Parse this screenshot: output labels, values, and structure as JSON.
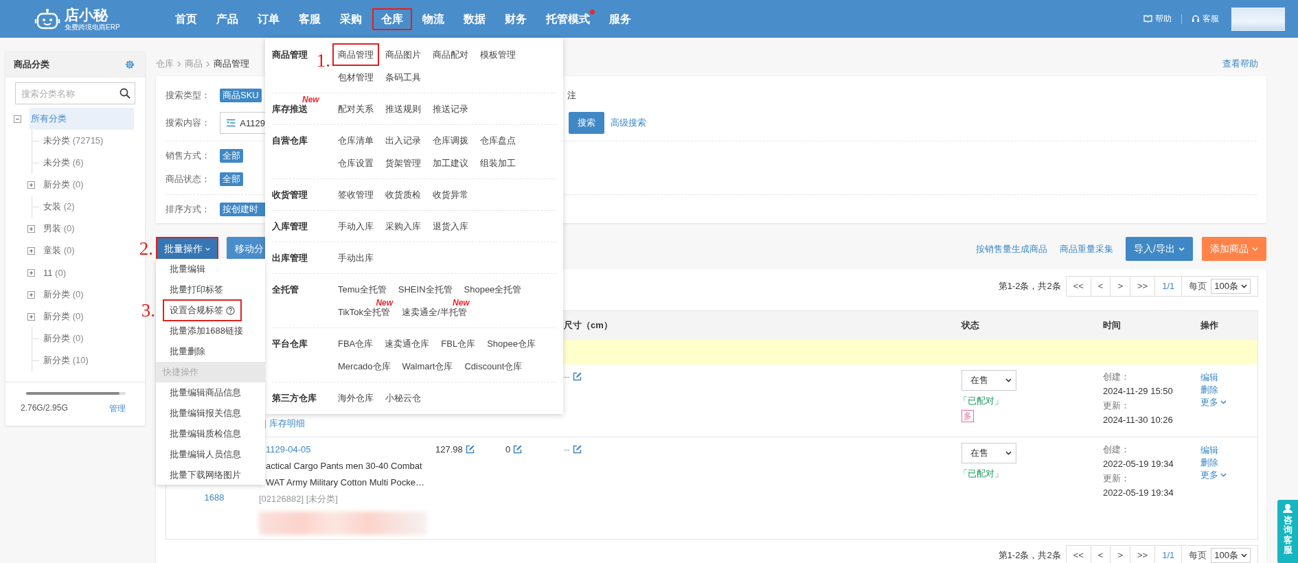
{
  "header": {
    "logo": {
      "name": "店小秘",
      "tagline": "免费跨境电商ERP"
    },
    "nav": [
      {
        "label": "首页",
        "boxed": false,
        "dot": false
      },
      {
        "label": "产品",
        "boxed": false,
        "dot": false
      },
      {
        "label": "订单",
        "boxed": false,
        "dot": false
      },
      {
        "label": "客服",
        "boxed": false,
        "dot": false
      },
      {
        "label": "采购",
        "boxed": false,
        "dot": false
      },
      {
        "label": "仓库",
        "boxed": true,
        "dot": false
      },
      {
        "label": "物流",
        "boxed": false,
        "dot": false
      },
      {
        "label": "数据",
        "boxed": false,
        "dot": false
      },
      {
        "label": "财务",
        "boxed": false,
        "dot": false
      },
      {
        "label": "托管模式",
        "boxed": false,
        "dot": true
      },
      {
        "label": "服务",
        "boxed": false,
        "dot": false
      }
    ],
    "links": [
      {
        "label": "帮助",
        "kind": "help"
      },
      {
        "label": "客服",
        "kind": "service"
      }
    ]
  },
  "sidebar": {
    "title": "商品分类",
    "search_placeholder": "搜索分类名称",
    "tree": [
      {
        "label": "所有分类",
        "kind": "folder",
        "expanded": true,
        "selected": true,
        "children": [
          {
            "label": "未分类",
            "count": "(72715)",
            "kind": "leaf",
            "selected": false
          },
          {
            "label": "未分类",
            "count": "(6)",
            "kind": "leaf",
            "selected": false
          },
          {
            "label": "新分类",
            "count": "(0)",
            "kind": "folder",
            "expanded": false,
            "selected": false
          },
          {
            "label": "女装",
            "count": "(2)",
            "kind": "leaf",
            "selected": false
          },
          {
            "label": "男装",
            "count": "(0)",
            "kind": "folder",
            "expanded": false,
            "selected": false
          },
          {
            "label": "童装",
            "count": "(0)",
            "kind": "folder",
            "expanded": false,
            "selected": false
          },
          {
            "label": "11",
            "count": "(0)",
            "kind": "folder",
            "expanded": false,
            "selected": false
          },
          {
            "label": "新分类",
            "count": "(0)",
            "kind": "folder",
            "expanded": false,
            "selected": false
          },
          {
            "label": "新分类",
            "count": "(0)",
            "kind": "folder",
            "expanded": false,
            "selected": false
          },
          {
            "label": "新分类",
            "count": "(0)",
            "kind": "leaf",
            "selected": false
          },
          {
            "label": "新分类",
            "count": "(10)",
            "kind": "leaf",
            "selected": false
          }
        ]
      }
    ],
    "storage": {
      "level": 0.935,
      "text": "2.76G/2.95G",
      "link": "管理"
    }
  },
  "breadcrumb": [
    "仓库",
    "商品",
    "商品管理"
  ],
  "help_link": "查看帮助",
  "search": {
    "groups": [
      [
        {
          "label": "搜索类型：",
          "kind": "tags",
          "tag": "商品SKU",
          "trailing": "注"
        },
        {
          "label": "搜索内容：",
          "kind": "input",
          "value": "A1129",
          "button": "搜索",
          "link": "高级搜索"
        }
      ],
      [
        {
          "label": "销售方式：",
          "kind": "tags",
          "tag": "全部"
        },
        {
          "label": "商品状态：",
          "kind": "tags",
          "tag": "全部"
        }
      ],
      [
        {
          "label": "排序方式：",
          "kind": "tags",
          "tag": "按创建时"
        }
      ]
    ]
  },
  "toolbar": {
    "left": [
      {
        "label": "批量操作",
        "kind": "dropdown",
        "boxed": true,
        "annotation": "2."
      },
      {
        "label": "移动分",
        "kind": "plain",
        "boxed": false
      }
    ],
    "links": [
      "按销售量生成商品",
      "商品重量采集"
    ],
    "buttons": [
      {
        "label": "导入/导出",
        "kind": "primary"
      },
      {
        "label": "添加商品",
        "kind": "warning"
      }
    ]
  },
  "pagination_top": {
    "summary": "第1-2条，共2条",
    "pages": [
      {
        "label": "<<",
        "selected": false
      },
      {
        "label": "<",
        "selected": false
      },
      {
        "label": ">",
        "selected": false
      },
      {
        "label": ">>",
        "selected": false
      },
      {
        "label": "1/1",
        "selected": true
      }
    ],
    "per_page_label": "每页",
    "per_page": "100条"
  },
  "table": {
    "columns": [
      "尺寸（cm）",
      "状态",
      "时间",
      "操作"
    ],
    "rows": [
      {
        "stock_link": "库存明细",
        "size": "--",
        "status": "在售",
        "paired": "「已配对」",
        "multi": "多",
        "created_label": "创建：",
        "created": "2024-11-29 15:50",
        "updated_label": "更新：",
        "updated": "2024-11-30 10:26",
        "actions": [
          "编辑",
          "删除",
          "更多"
        ]
      },
      {
        "source": "1688",
        "code": "1129-04-05",
        "title_lines": [
          "actical Cargo Pants men 30-40 Combat",
          "WAT Army Military Cotton Multi Pocke…"
        ],
        "meta": "[02126882] [未分类]",
        "price": "127.98",
        "qty": "0",
        "size": "--",
        "status": "在售",
        "paired": "「已配对」",
        "created_label": "创建：",
        "created": "2022-05-19 19:34",
        "updated_label": "更新：",
        "updated": "2022-05-19 19:34",
        "actions": [
          "编辑",
          "删除",
          "更多"
        ]
      }
    ]
  },
  "pagination_bottom": {
    "summary": "第1-2条，共2条",
    "pages": [
      {
        "label": "<<",
        "selected": false
      },
      {
        "label": "<",
        "selected": false
      },
      {
        "label": ">",
        "selected": false
      },
      {
        "label": ">>",
        "selected": false
      },
      {
        "label": "1/1",
        "selected": true
      }
    ],
    "per_page_label": "每页",
    "per_page": "100条"
  },
  "warehouse_menu": [
    {
      "title": "商品管理",
      "rows": [
        [
          {
            "label": "商品管理",
            "boxed": true,
            "annotation": "1."
          },
          {
            "label": "商品图片",
            "boxed": false
          },
          {
            "label": "商品配对",
            "boxed": false
          },
          {
            "label": "模板管理",
            "boxed": false
          }
        ],
        [
          {
            "label": "包材管理",
            "boxed": false
          },
          {
            "label": "条码工具",
            "boxed": false
          }
        ]
      ]
    },
    {
      "title": "库存推送",
      "badge": "New",
      "rows": [
        [
          {
            "label": "配对关系",
            "boxed": false
          },
          {
            "label": "推送规则",
            "boxed": false
          },
          {
            "label": "推送记录",
            "boxed": false
          }
        ]
      ]
    },
    {
      "title": "自营仓库",
      "rows": [
        [
          {
            "label": "仓库清单",
            "boxed": false
          },
          {
            "label": "出入记录",
            "boxed": false
          },
          {
            "label": "仓库调拨",
            "boxed": false
          },
          {
            "label": "仓库盘点",
            "boxed": false
          }
        ],
        [
          {
            "label": "仓库设置",
            "boxed": false
          },
          {
            "label": "货架管理",
            "boxed": false
          },
          {
            "label": "加工建议",
            "boxed": false
          },
          {
            "label": "组装加工",
            "boxed": false
          }
        ]
      ]
    },
    {
      "title": "收货管理",
      "rows": [
        [
          {
            "label": "签收管理",
            "boxed": false
          },
          {
            "label": "收货质检",
            "boxed": false
          },
          {
            "label": "收货异常",
            "boxed": false
          }
        ]
      ]
    },
    {
      "title": "入库管理",
      "rows": [
        [
          {
            "label": "手动入库",
            "boxed": false
          },
          {
            "label": "采购入库",
            "boxed": false
          },
          {
            "label": "退货入库",
            "boxed": false
          }
        ]
      ]
    },
    {
      "title": "出库管理",
      "rows": [
        [
          {
            "label": "手动出库",
            "boxed": false
          }
        ]
      ]
    },
    {
      "title": "全托管",
      "rows": [
        [
          {
            "label": "Temu全托管",
            "boxed": false
          },
          {
            "label": "SHEIN全托管",
            "boxed": false
          },
          {
            "label": "Shopee全托管",
            "boxed": false
          }
        ],
        [
          {
            "label": "TikTok全托管",
            "badge": "New",
            "boxed": false
          },
          {
            "label": "速卖通全/半托管",
            "badge": "New",
            "boxed": false
          }
        ]
      ]
    },
    {
      "title": "平台仓库",
      "rows": [
        [
          {
            "label": "FBA仓库",
            "boxed": false
          },
          {
            "label": "速卖通仓库",
            "boxed": false
          },
          {
            "label": "FBL仓库",
            "boxed": false
          },
          {
            "label": "Shopee仓库",
            "boxed": false
          }
        ],
        [
          {
            "label": "Mercado仓库",
            "boxed": false
          },
          {
            "label": "Walmart仓库",
            "boxed": false
          },
          {
            "label": "Cdiscount仓库",
            "boxed": false
          }
        ]
      ]
    },
    {
      "title": "第三方仓库",
      "rows": [
        [
          {
            "label": "海外仓库",
            "boxed": false
          },
          {
            "label": "小秘云仓",
            "boxed": false
          }
        ]
      ]
    }
  ],
  "batch_menu": [
    {
      "label": "批量编辑",
      "kind": "item"
    },
    {
      "label": "批量打印标签",
      "kind": "item"
    },
    {
      "label": "设置合规标签",
      "kind": "item",
      "help": true,
      "boxed": true,
      "annotation": "3."
    },
    {
      "label": "批量添加1688链接",
      "kind": "item"
    },
    {
      "label": "批量删除",
      "kind": "item"
    },
    {
      "label": "快捷操作",
      "kind": "header"
    },
    {
      "label": "批量编辑商品信息",
      "kind": "item"
    },
    {
      "label": "批量编辑报关信息",
      "kind": "item"
    },
    {
      "label": "批量编辑质检信息",
      "kind": "item"
    },
    {
      "label": "批量编辑人员信息",
      "kind": "item"
    },
    {
      "label": "批量下载网络图片",
      "kind": "item"
    }
  ],
  "consult": "咨询客服"
}
